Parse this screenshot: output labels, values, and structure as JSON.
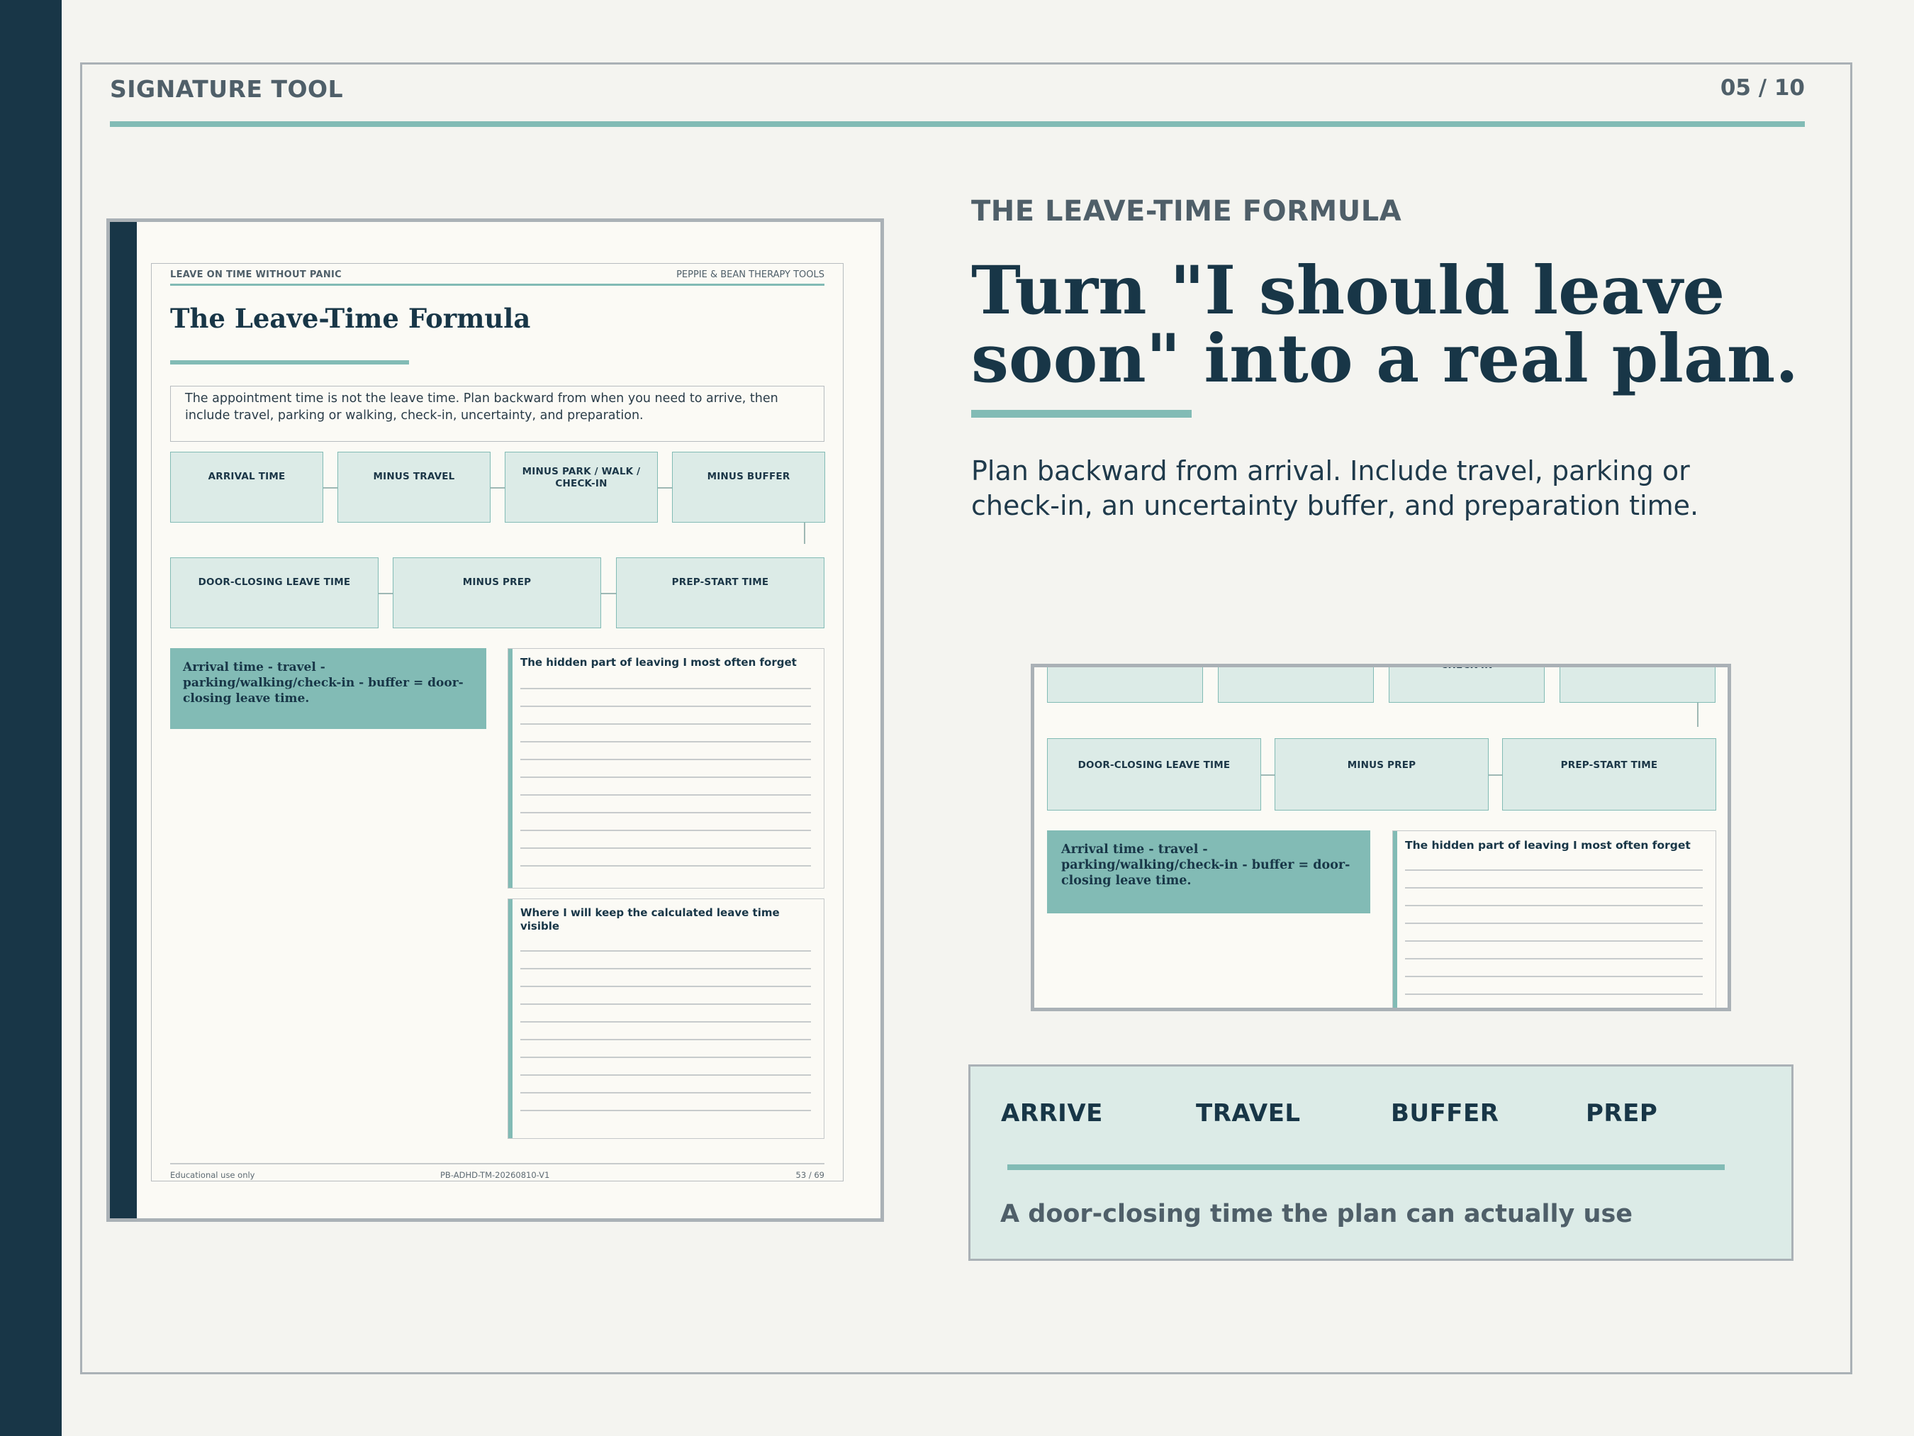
{
  "header": {
    "label": "SIGNATURE TOOL",
    "page": "05 / 10"
  },
  "worksheet": {
    "header_left": "LEAVE ON TIME WITHOUT PANIC",
    "header_right": "PEPPIE & BEAN THERAPY TOOLS",
    "title": "The Leave-Time Formula",
    "intro": "The appointment time is not the leave time. Plan backward from when you need to arrive, then include travel, parking or walking, check-in, uncertainty, and preparation.",
    "steps_row1": [
      "ARRIVAL TIME",
      "MINUS TRAVEL",
      "MINUS PARK / WALK / CHECK-IN",
      "MINUS BUFFER"
    ],
    "steps_row2": [
      "DOOR-CLOSING LEAVE TIME",
      "MINUS PREP",
      "PREP-START TIME"
    ],
    "formula": "Arrival time - travel - parking/walking/check-in - buffer = door-closing leave time.",
    "note1_title": "The hidden part of leaving I most often forget",
    "note2_title": "Where I will keep the calculated leave time visible",
    "footer_left": "Educational use only",
    "footer_center": "PB-ADHD-TM-20260810-V1",
    "footer_right": "53 / 69"
  },
  "zoom": {
    "partial_label": "CHECK-IN"
  },
  "content": {
    "eyebrow": "THE LEAVE-TIME FORMULA",
    "headline": "Turn \"I should leave soon\" into a real plan.",
    "lede": "Plan backward from arrival. Include travel, parking or check-in, an uncertainty buffer, and preparation time."
  },
  "summary": {
    "words": [
      "ARRIVE",
      "TRAVEL",
      "BUFFER",
      "PREP"
    ],
    "note": "A door-closing time the plan can actually use"
  },
  "colors": {
    "navy": "#183647",
    "teal": "#82bbb5",
    "pale_teal": "#dcebe7",
    "background": "#f4f4f0"
  }
}
